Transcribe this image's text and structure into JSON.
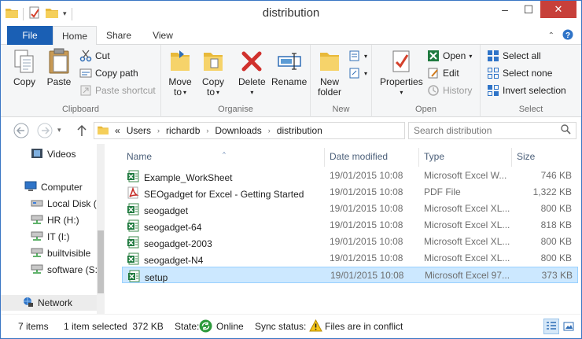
{
  "window": {
    "title": "distribution",
    "minimize_glyph": "–",
    "maximize_glyph": "☐",
    "close_glyph": "✕"
  },
  "ribbon_tabs": [
    "File",
    "Home",
    "Share",
    "View"
  ],
  "ribbon": {
    "clipboard": {
      "label": "Clipboard",
      "copy": "Copy",
      "paste": "Paste",
      "cut": "Cut",
      "copy_path": "Copy path",
      "paste_shortcut": "Paste shortcut"
    },
    "organise": {
      "label": "Organise",
      "move_to_1": "Move",
      "move_to_2": "to",
      "copy_to_1": "Copy",
      "copy_to_2": "to",
      "delete": "Delete",
      "rename": "Rename"
    },
    "new": {
      "label": "New",
      "new_folder_1": "New",
      "new_folder_2": "folder"
    },
    "open": {
      "label": "Open",
      "properties": "Properties",
      "open": "Open",
      "edit": "Edit",
      "history": "History"
    },
    "select": {
      "label": "Select",
      "select_all": "Select all",
      "select_none": "Select none",
      "invert_selection": "Invert selection"
    }
  },
  "address": {
    "overflow": "«",
    "crumbs": [
      "Users",
      "richardb",
      "Downloads",
      "distribution"
    ],
    "search_placeholder": "Search distribution"
  },
  "nav_pane": {
    "items": [
      "Videos",
      "Computer",
      "Local Disk (",
      "HR (H:)",
      "IT (I:)",
      "builtvisible",
      "software (S:",
      "Network"
    ]
  },
  "columns": {
    "name": "Name",
    "date": "Date modified",
    "type": "Type",
    "size": "Size"
  },
  "files": [
    {
      "name": "Example_WorkSheet",
      "date": "19/01/2015 10:08",
      "type": "Microsoft Excel W...",
      "size": "746 KB",
      "icon": "excel-icon"
    },
    {
      "name": "SEOgadget for Excel - Getting Started",
      "date": "19/01/2015 10:08",
      "type": "PDF File",
      "size": "1,322 KB",
      "icon": "pdf-icon"
    },
    {
      "name": "seogadget",
      "date": "19/01/2015 10:08",
      "type": "Microsoft Excel XL...",
      "size": "800 KB",
      "icon": "excel-icon"
    },
    {
      "name": "seogadget-64",
      "date": "19/01/2015 10:08",
      "type": "Microsoft Excel XL...",
      "size": "818 KB",
      "icon": "excel-icon"
    },
    {
      "name": "seogadget-2003",
      "date": "19/01/2015 10:08",
      "type": "Microsoft Excel XL...",
      "size": "800 KB",
      "icon": "excel-icon"
    },
    {
      "name": "seogadget-N4",
      "date": "19/01/2015 10:08",
      "type": "Microsoft Excel XL...",
      "size": "800 KB",
      "icon": "excel-icon"
    },
    {
      "name": "setup",
      "date": "19/01/2015 10:08",
      "type": "Microsoft Excel 97...",
      "size": "373 KB",
      "icon": "excel-icon",
      "selected": true
    }
  ],
  "status": {
    "item_count": "7 items",
    "selection": "1 item selected  372 KB",
    "state_label": "State:",
    "state_value": "Online",
    "sync_label": "Sync status:",
    "sync_value": "Files are in conflict"
  },
  "colors": {
    "file_tab": "#1a5fb4",
    "close_button": "#c7403a",
    "selection_bg": "#cce8ff",
    "selection_border": "#99d1ff",
    "column_header": "#4c607a"
  }
}
